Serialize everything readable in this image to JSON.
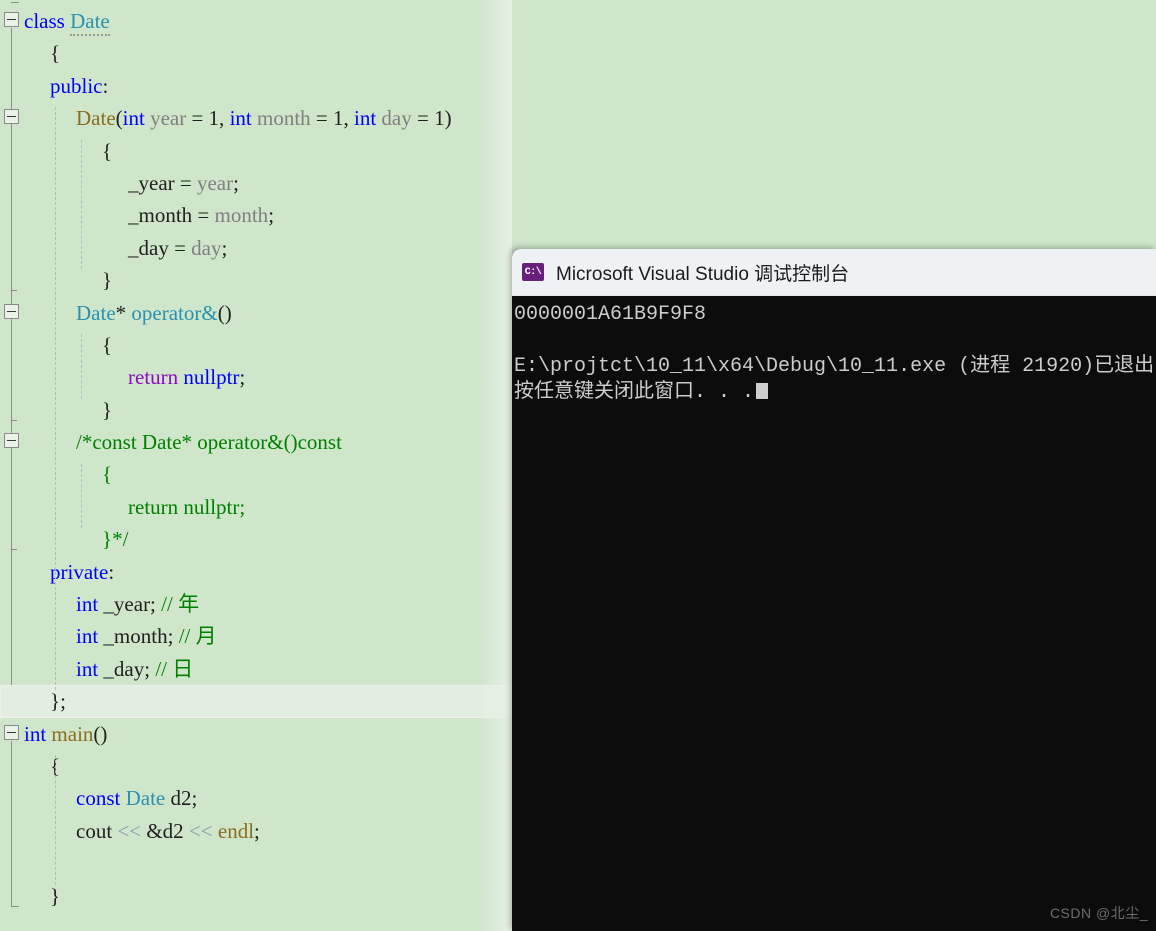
{
  "editor": {
    "background_color": "#cfe6cb",
    "current_line_index": 21,
    "language": "C++",
    "lines": [
      {
        "indent": 0,
        "fold": "start",
        "tokens": [
          {
            "t": "class ",
            "c": "k"
          },
          {
            "t": "Date",
            "c": "type squig"
          }
        ]
      },
      {
        "indent": 1,
        "fold": "bar",
        "tokens": [
          {
            "t": "{",
            "c": "pl"
          }
        ]
      },
      {
        "indent": 1,
        "fold": "bar",
        "tokens": [
          {
            "t": "public",
            "c": "k"
          },
          {
            "t": ":",
            "c": "pl"
          }
        ]
      },
      {
        "indent": 2,
        "fold": "start",
        "tokens": [
          {
            "t": "Date",
            "c": "fn"
          },
          {
            "t": "(",
            "c": "pl"
          },
          {
            "t": "int",
            "c": "k"
          },
          {
            "t": " ",
            "c": "pl"
          },
          {
            "t": "year",
            "c": "par"
          },
          {
            "t": " = 1, ",
            "c": "pl"
          },
          {
            "t": "int",
            "c": "k"
          },
          {
            "t": " ",
            "c": "pl"
          },
          {
            "t": "month",
            "c": "par"
          },
          {
            "t": " = 1, ",
            "c": "pl"
          },
          {
            "t": "int",
            "c": "k"
          },
          {
            "t": " ",
            "c": "pl"
          },
          {
            "t": "day",
            "c": "par"
          },
          {
            "t": " = 1)",
            "c": "pl"
          }
        ]
      },
      {
        "indent": 3,
        "fold": "bar",
        "tokens": [
          {
            "t": "{",
            "c": "pl"
          }
        ]
      },
      {
        "indent": 4,
        "fold": "bar",
        "tokens": [
          {
            "t": "_year = ",
            "c": "pl"
          },
          {
            "t": "year",
            "c": "par"
          },
          {
            "t": ";",
            "c": "pl"
          }
        ]
      },
      {
        "indent": 4,
        "fold": "bar",
        "tokens": [
          {
            "t": "_month = ",
            "c": "pl"
          },
          {
            "t": "month",
            "c": "par"
          },
          {
            "t": ";",
            "c": "pl"
          }
        ]
      },
      {
        "indent": 4,
        "fold": "bar",
        "tokens": [
          {
            "t": "_day = ",
            "c": "pl"
          },
          {
            "t": "day",
            "c": "par"
          },
          {
            "t": ";",
            "c": "pl"
          }
        ]
      },
      {
        "indent": 3,
        "fold": "end",
        "tokens": [
          {
            "t": "}",
            "c": "pl"
          }
        ]
      },
      {
        "indent": 2,
        "fold": "start",
        "tokens": [
          {
            "t": "Date",
            "c": "type"
          },
          {
            "t": "* ",
            "c": "pl"
          },
          {
            "t": "operator&",
            "c": "type"
          },
          {
            "t": "()",
            "c": "pl"
          }
        ]
      },
      {
        "indent": 3,
        "fold": "bar",
        "tokens": [
          {
            "t": "{",
            "c": "pl"
          }
        ]
      },
      {
        "indent": 4,
        "fold": "bar",
        "tokens": [
          {
            "t": "return",
            "c": "ctl"
          },
          {
            "t": " ",
            "c": "pl"
          },
          {
            "t": "nullptr",
            "c": "k"
          },
          {
            "t": ";",
            "c": "pl"
          }
        ]
      },
      {
        "indent": 3,
        "fold": "end",
        "tokens": [
          {
            "t": "}",
            "c": "pl"
          }
        ]
      },
      {
        "indent": 2,
        "fold": "start",
        "tokens": [
          {
            "t": "/*const Date* operator&()const",
            "c": "cmt"
          }
        ]
      },
      {
        "indent": 3,
        "fold": "bar",
        "tokens": [
          {
            "t": "{",
            "c": "cmt"
          }
        ]
      },
      {
        "indent": 4,
        "fold": "bar",
        "tokens": [
          {
            "t": "return nullptr;",
            "c": "cmt"
          }
        ]
      },
      {
        "indent": 3,
        "fold": "end",
        "tokens": [
          {
            "t": "}*/",
            "c": "cmt"
          }
        ]
      },
      {
        "indent": 1,
        "fold": "bar",
        "tokens": [
          {
            "t": "private",
            "c": "k"
          },
          {
            "t": ":",
            "c": "pl"
          }
        ]
      },
      {
        "indent": 2,
        "fold": "bar",
        "tokens": [
          {
            "t": "int",
            "c": "k"
          },
          {
            "t": " _year; ",
            "c": "pl"
          },
          {
            "t": "// 年",
            "c": "cmt"
          }
        ]
      },
      {
        "indent": 2,
        "fold": "bar",
        "tokens": [
          {
            "t": "int",
            "c": "k"
          },
          {
            "t": " _month; ",
            "c": "pl"
          },
          {
            "t": "// 月",
            "c": "cmt"
          }
        ]
      },
      {
        "indent": 2,
        "fold": "bar",
        "tokens": [
          {
            "t": "int",
            "c": "k"
          },
          {
            "t": " _day; ",
            "c": "pl"
          },
          {
            "t": "// 日",
            "c": "cmt"
          }
        ]
      },
      {
        "indent": 1,
        "fold": "end",
        "tokens": [
          {
            "t": "};",
            "c": "pl"
          }
        ]
      },
      {
        "indent": 0,
        "fold": "start",
        "tokens": [
          {
            "t": "int",
            "c": "k"
          },
          {
            "t": " ",
            "c": "pl"
          },
          {
            "t": "main",
            "c": "fn"
          },
          {
            "t": "()",
            "c": "pl"
          }
        ]
      },
      {
        "indent": 1,
        "fold": "bar",
        "tokens": [
          {
            "t": "{",
            "c": "pl"
          }
        ]
      },
      {
        "indent": 2,
        "fold": "bar",
        "tokens": [
          {
            "t": "const",
            "c": "k"
          },
          {
            "t": " ",
            "c": "pl"
          },
          {
            "t": "Date",
            "c": "type"
          },
          {
            "t": " d2;",
            "c": "pl"
          }
        ]
      },
      {
        "indent": 2,
        "fold": "bar",
        "tokens": [
          {
            "t": "cout ",
            "c": "pl"
          },
          {
            "t": "<<",
            "c": "op"
          },
          {
            "t": " &d2 ",
            "c": "pl"
          },
          {
            "t": "<<",
            "c": "op"
          },
          {
            "t": " ",
            "c": "pl"
          },
          {
            "t": "endl",
            "c": "fn"
          },
          {
            "t": ";",
            "c": "pl"
          }
        ]
      },
      {
        "indent": 2,
        "fold": "bar",
        "tokens": [
          {
            "t": "",
            "c": "pl"
          }
        ]
      },
      {
        "indent": 1,
        "fold": "end",
        "tokens": [
          {
            "t": "}",
            "c": "pl"
          }
        ]
      }
    ]
  },
  "console": {
    "title": "Microsoft Visual Studio 调试控制台",
    "icon_label": "C:\\",
    "icon_color": "#68217a",
    "background_color": "#0c0c0c",
    "text_color": "#cccccc",
    "lines": [
      "0000001A61B9F9F8",
      "",
      "E:\\projtct\\10_11\\x64\\Debug\\10_11.exe (进程 21920)已退出",
      "按任意键关闭此窗口. . ."
    ]
  },
  "watermark": {
    "text": "CSDN @北尘_"
  }
}
